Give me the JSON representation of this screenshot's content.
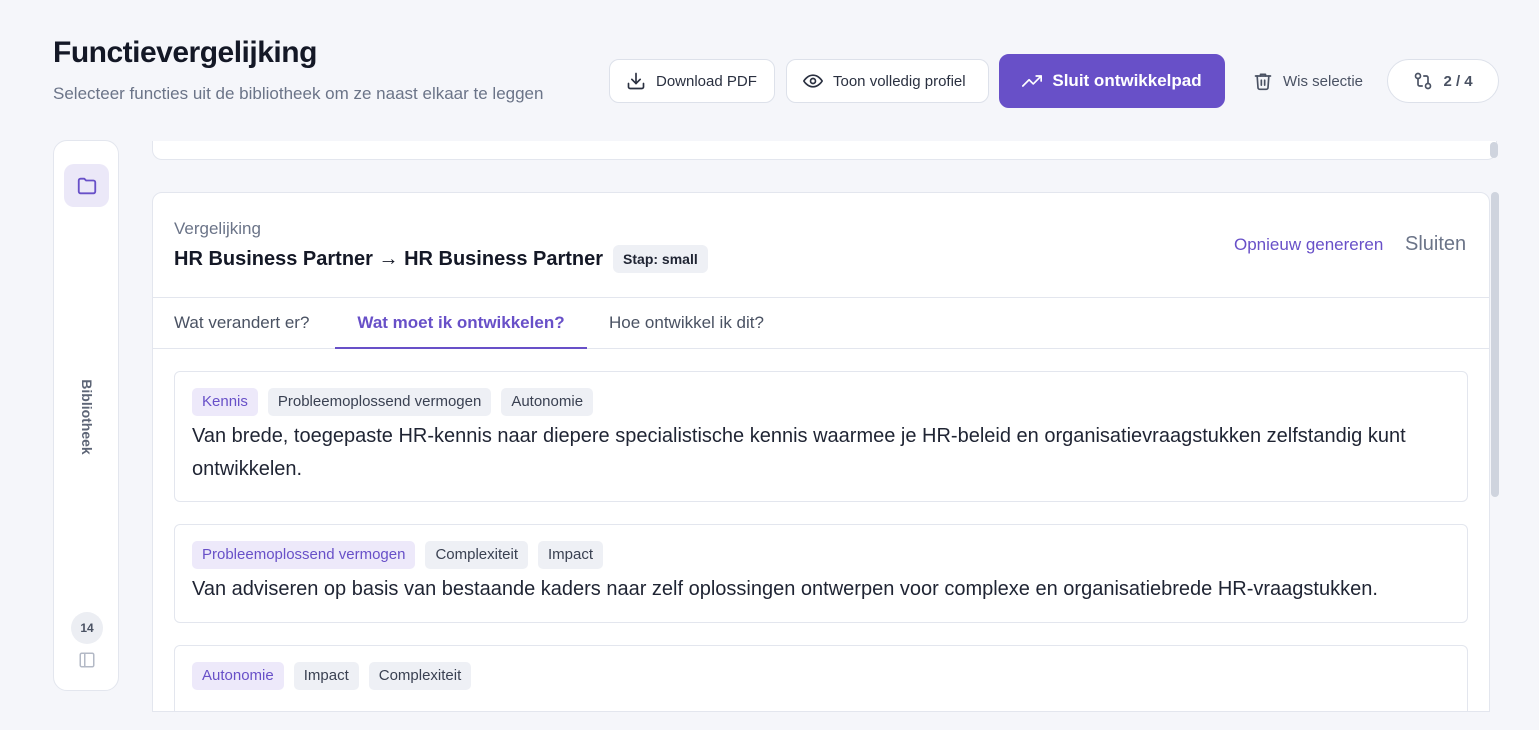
{
  "header": {
    "title": "Functievergelijking",
    "subtitle": "Selecteer functies uit de bibliotheek om ze naast elkaar te leggen"
  },
  "toolbar": {
    "download_label": "Download PDF",
    "profile_label": "Toon volledig profiel",
    "path_label": "Sluit ontwikkelpad",
    "clear_label": "Wis selectie",
    "count_label": "2 / 4"
  },
  "sidebar": {
    "label": "Bibliotheek",
    "count": "14"
  },
  "comparison": {
    "label": "Vergelijking",
    "heading": "HR Business Partner → HR Business Partner",
    "step_badge": "Stap: small",
    "regenerate_label": "Opnieuw genereren",
    "close_label": "Sluiten",
    "tabs": [
      {
        "label": "Wat verandert er?"
      },
      {
        "label": "Wat moet ik ontwikkelen?"
      },
      {
        "label": "Hoe ontwikkel ik dit?"
      }
    ],
    "items": [
      {
        "chips": [
          "Kennis",
          "Probleemoplossend vermogen",
          "Autonomie"
        ],
        "text": "Van brede, toegepaste HR-kennis naar diepere specialistische kennis waarmee je HR-beleid en organisatievraagstukken zelfstandig kunt ontwikkelen."
      },
      {
        "chips": [
          "Probleemoplossend vermogen",
          "Complexiteit",
          "Impact"
        ],
        "text": "Van adviseren op basis van bestaande kaders naar zelf oplossingen ontwerpen voor complexe en organisatiebrede HR-vraagstukken."
      },
      {
        "chips": [
          "Autonomie",
          "Impact",
          "Complexiteit"
        ],
        "text": ""
      }
    ]
  },
  "colors": {
    "accent": "#6850c8",
    "accent_soft": "#ede9fa",
    "background": "#f5f6fa"
  },
  "icons": {
    "download": "download-icon",
    "eye": "eye-icon",
    "trend": "trending-up-icon",
    "trash": "trash-icon",
    "compare": "git-compare-icon",
    "folder": "folder-icon",
    "panel": "sidebar-panel-icon"
  }
}
